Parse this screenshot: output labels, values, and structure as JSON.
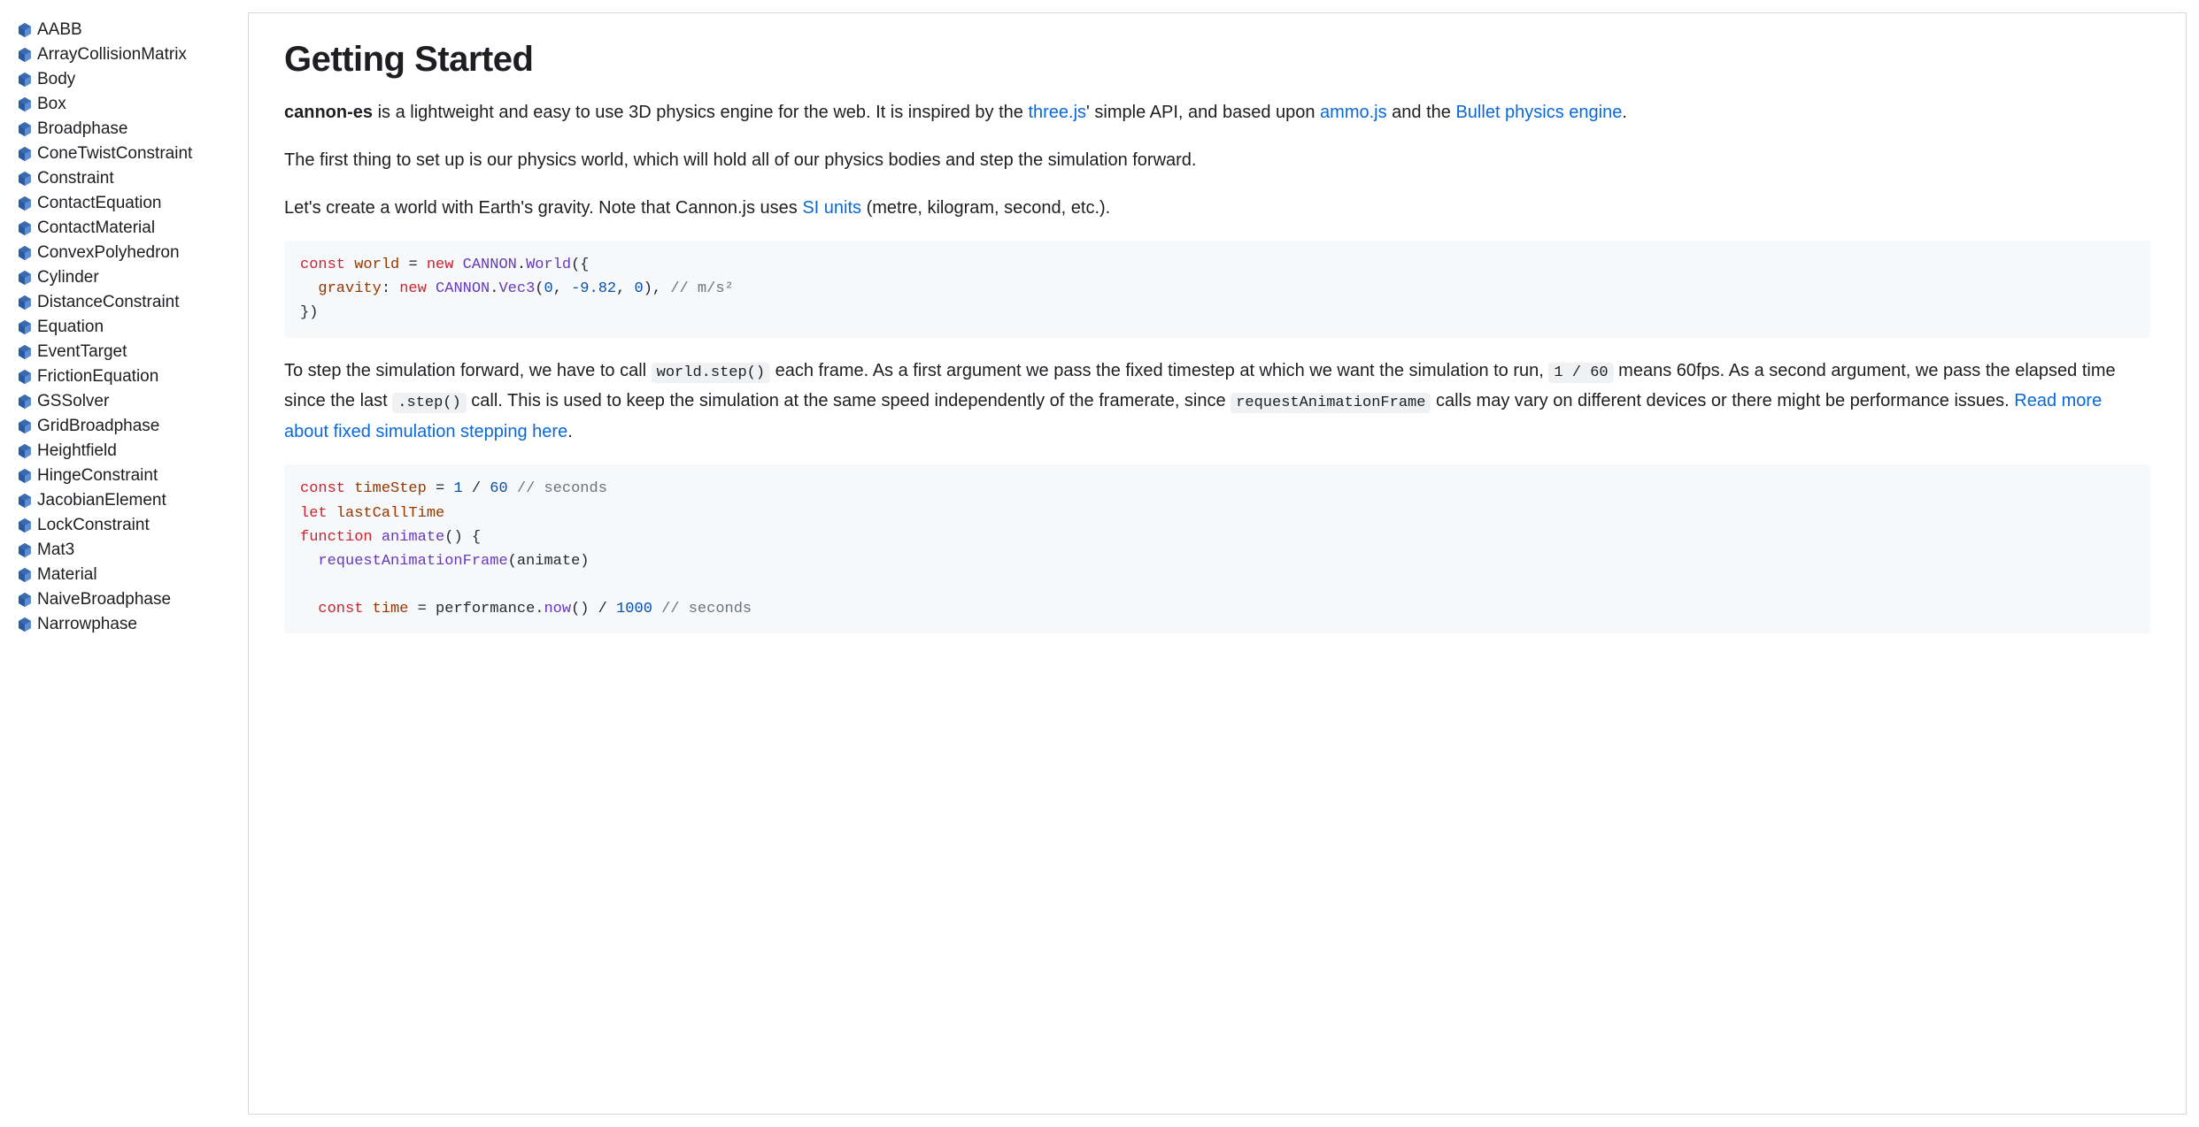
{
  "sidebar": {
    "items": [
      "AABB",
      "ArrayCollisionMatrix",
      "Body",
      "Box",
      "Broadphase",
      "ConeTwistConstraint",
      "Constraint",
      "ContactEquation",
      "ContactMaterial",
      "ConvexPolyhedron",
      "Cylinder",
      "DistanceConstraint",
      "Equation",
      "EventTarget",
      "FrictionEquation",
      "GSSolver",
      "GridBroadphase",
      "Heightfield",
      "HingeConstraint",
      "JacobianElement",
      "LockConstraint",
      "Mat3",
      "Material",
      "NaiveBroadphase",
      "Narrowphase"
    ]
  },
  "content": {
    "heading": "Getting Started",
    "p1": {
      "strong": "cannon-es",
      "t1": " is a lightweight and easy to use 3D physics engine for the web. It is inspired by the ",
      "link1": "three.js",
      "t2": "' simple API, and based upon ",
      "link2": "ammo.js",
      "t3": " and the ",
      "link3": "Bullet physics engine",
      "t4": "."
    },
    "p2": "The first thing to set up is our physics world, which will hold all of our physics bodies and step the simulation forward.",
    "p3": {
      "t1": "Let's create a world with Earth's gravity. Note that Cannon.js uses ",
      "link1": "SI units",
      "t2": " (metre, kilogram, second, etc.)."
    },
    "code1": {
      "line1": {
        "kw": "const",
        "var": " world ",
        "op": "= ",
        "new": "new",
        "space": " ",
        "class1": "CANNON",
        "dot": ".",
        "class2": "World",
        "paren": "({"
      },
      "line2": {
        "indent": "  ",
        "prop": "gravity",
        "colon": ": ",
        "new": "new",
        "space": " ",
        "class1": "CANNON",
        "dot": ".",
        "class2": "Vec3",
        "open": "(",
        "n1": "0",
        "c1": ", ",
        "n2": "-9.82",
        "c2": ", ",
        "n3": "0",
        "close": "), ",
        "comment": "// m/s²"
      },
      "line3": {
        "close": "})"
      }
    },
    "p4": {
      "t1": "To step the simulation forward, we have to call ",
      "code1": "world.step()",
      "t2": " each frame. As a first argument we pass the fixed timestep at which we want the simulation to run, ",
      "code2": "1 / 60",
      "t3": " means 60fps. As a second argument, we pass the elapsed time since the last ",
      "code3": ".step()",
      "t4": " call. This is used to keep the simulation at the same speed independently of the framerate, since ",
      "code4": "requestAnimationFrame",
      "t5": " calls may vary on different devices or there might be performance issues. ",
      "link1": "Read more about fixed simulation stepping here",
      "t6": "."
    },
    "code2": {
      "line1": {
        "kw": "const",
        "var": " timeStep ",
        "op": "= ",
        "n1": "1",
        "slash": " / ",
        "n2": "60",
        "space": " ",
        "comment": "// seconds"
      },
      "line2": {
        "kw": "let",
        "var": " lastCallTime"
      },
      "line3": {
        "kw": "function",
        "space": " ",
        "fn": "animate",
        "paren": "() {"
      },
      "line4": {
        "indent": "  ",
        "fn": "requestAnimationFrame",
        "paren": "(animate)"
      },
      "line5": "",
      "line6": {
        "indent": "  ",
        "kw": "const",
        "var": " time ",
        "op": "= ",
        "obj": "performance",
        "dot": ".",
        "fn": "now",
        "paren": "() / ",
        "num": "1000",
        "space": " ",
        "comment": "// seconds"
      }
    }
  }
}
